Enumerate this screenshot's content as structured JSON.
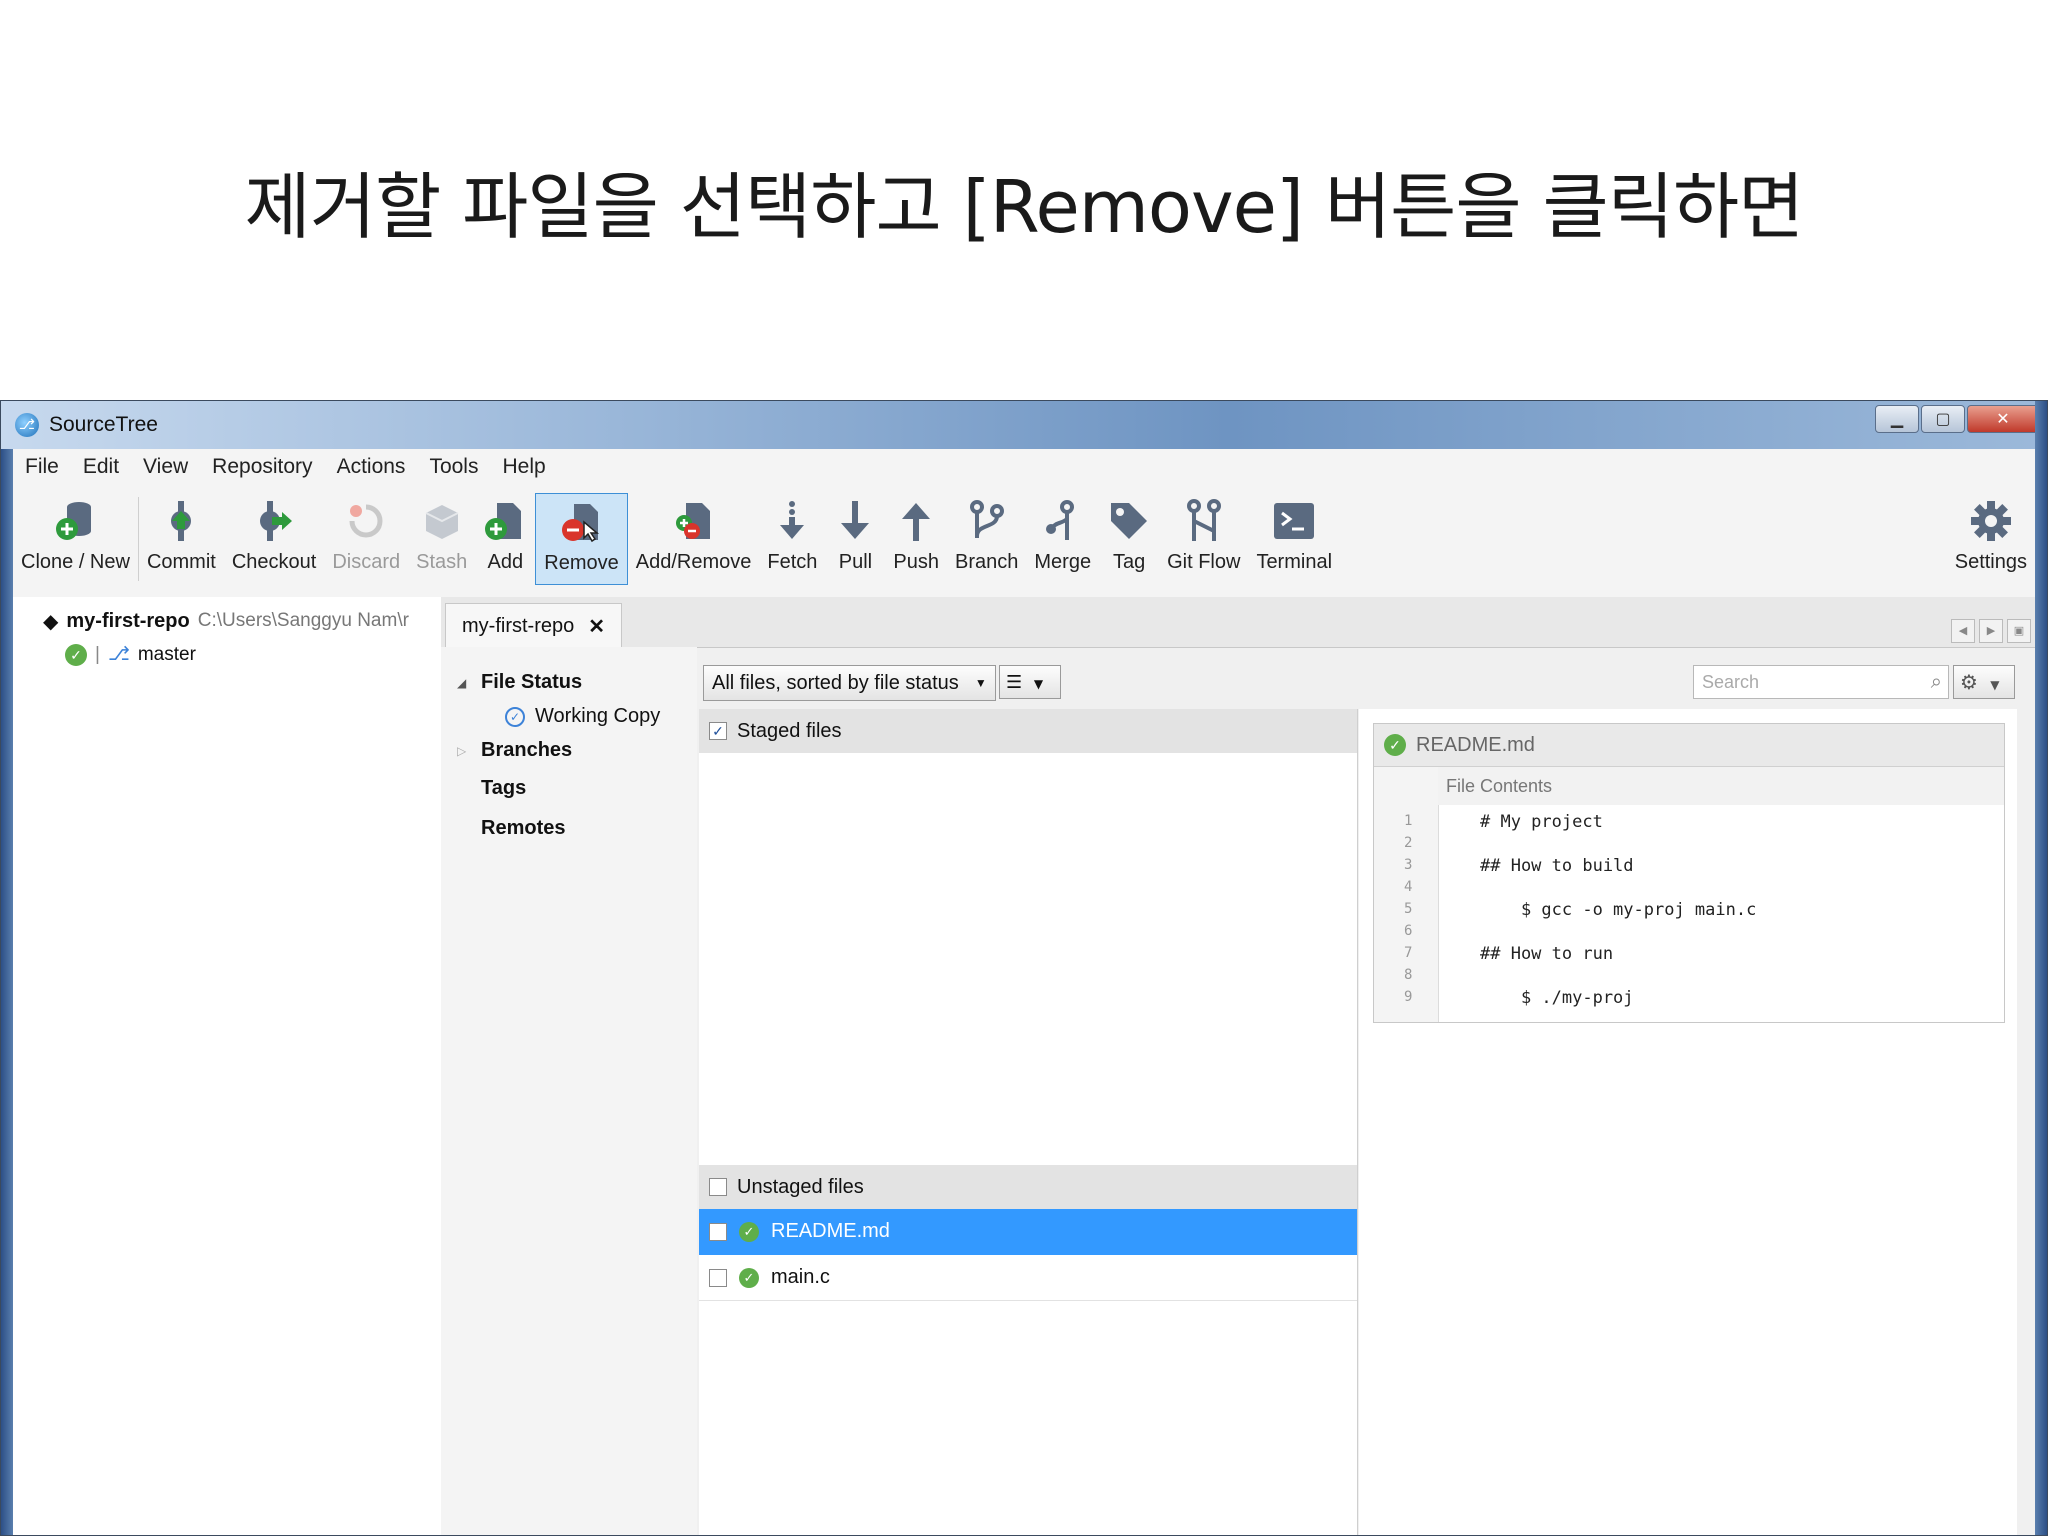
{
  "caption": "제거할 파일을 선택하고 [Remove] 버튼을 클릭하면",
  "window": {
    "title": "SourceTree"
  },
  "menu": [
    "File",
    "Edit",
    "View",
    "Repository",
    "Actions",
    "Tools",
    "Help"
  ],
  "toolbar": {
    "clone_new": "Clone / New",
    "commit": "Commit",
    "checkout": "Checkout",
    "discard": "Discard",
    "stash": "Stash",
    "add": "Add",
    "remove": "Remove",
    "add_remove": "Add/Remove",
    "fetch": "Fetch",
    "pull": "Pull",
    "push": "Push",
    "branch": "Branch",
    "merge": "Merge",
    "tag": "Tag",
    "git_flow": "Git Flow",
    "terminal": "Terminal",
    "settings": "Settings"
  },
  "sidebar": {
    "repo_name": "my-first-repo",
    "repo_path": "C:\\Users\\Sanggyu Nam\\r",
    "branch": "master"
  },
  "tab": {
    "label": "my-first-repo",
    "close": "✕"
  },
  "nav": {
    "file_status": "File Status",
    "working_copy": "Working Copy",
    "branches": "Branches",
    "tags": "Tags",
    "remotes": "Remotes"
  },
  "filter": {
    "selected": "All files, sorted by file status",
    "search_placeholder": "Search"
  },
  "staged": {
    "header": "Staged files",
    "checked": true
  },
  "unstaged": {
    "header": "Unstaged files",
    "files": [
      "README.md",
      "main.c"
    ],
    "selected_file": "README.md"
  },
  "preview": {
    "filename": "README.md",
    "subheader": "File Contents",
    "line_numbers": [
      "1",
      "2",
      "3",
      "4",
      "5",
      "6",
      "7",
      "8",
      "9"
    ],
    "lines": [
      "# My project",
      "",
      "## How to build",
      "",
      "    $ gcc -o my-proj main.c",
      "",
      "## How to run",
      "",
      "    $ ./my-proj"
    ]
  },
  "colors": {
    "selection": "#3399ff",
    "active_tool_bg": "#cce4f7",
    "ok_green": "#5fae4a",
    "remove_red": "#d9342b"
  }
}
